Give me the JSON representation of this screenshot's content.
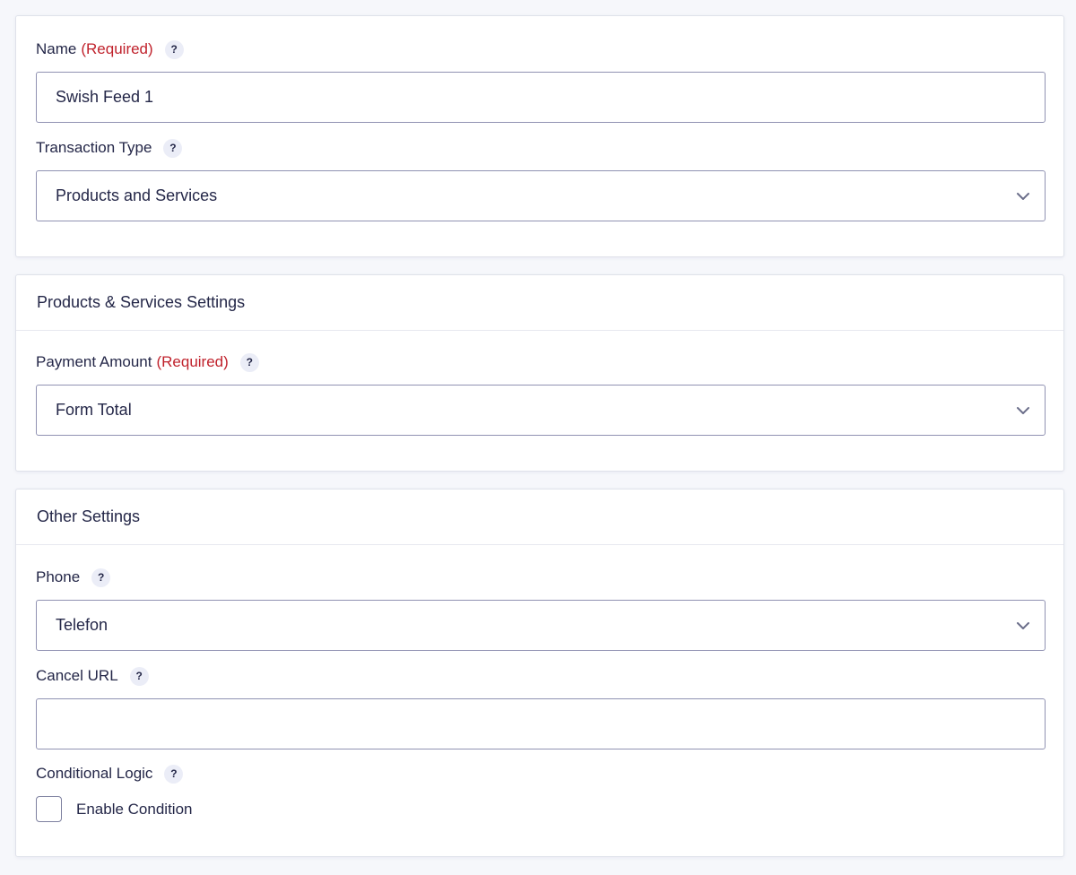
{
  "general": {
    "name_label": "Name",
    "name_required": "(Required)",
    "name_value": "Swish Feed 1",
    "transaction_type_label": "Transaction Type",
    "transaction_type_value": "Products and Services"
  },
  "products_services": {
    "title": "Products & Services Settings",
    "payment_amount_label": "Payment Amount",
    "payment_amount_required": "(Required)",
    "payment_amount_value": "Form Total"
  },
  "other_settings": {
    "title": "Other Settings",
    "phone_label": "Phone",
    "phone_value": "Telefon",
    "cancel_url_label": "Cancel URL",
    "cancel_url_value": "",
    "conditional_logic_label": "Conditional Logic",
    "enable_condition_label": "Enable Condition",
    "enable_condition_checked": false
  },
  "help_glyph": "?",
  "icons": {
    "help": "question-mark-icon",
    "dropdown": "chevron-down-icon"
  },
  "colors": {
    "required": "#c0222c",
    "text": "#242748",
    "input_border": "#9092b2",
    "help_bg": "#ebedf7",
    "page_bg": "#f6f7fb"
  }
}
